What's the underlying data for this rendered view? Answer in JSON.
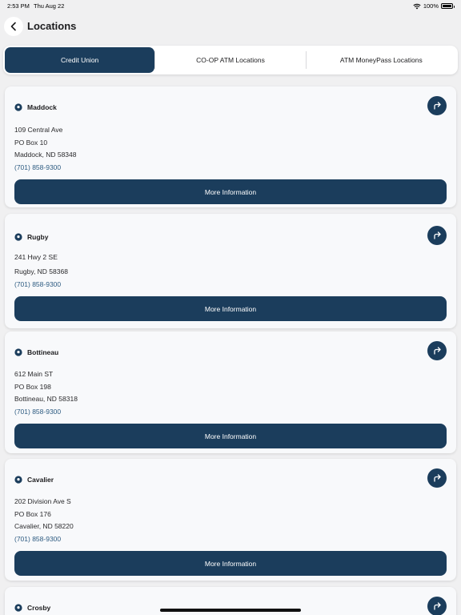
{
  "status": {
    "time": "2:53 PM",
    "date": "Thu Aug 22",
    "battery": "100%"
  },
  "nav": {
    "title": "Locations"
  },
  "tabs": [
    {
      "label": "Credit Union",
      "active": true
    },
    {
      "label": "CO-OP ATM Locations",
      "active": false
    },
    {
      "label": "ATM MoneyPass Locations",
      "active": false
    }
  ],
  "more_info_label": "More Information",
  "locations": [
    {
      "name": "Maddock",
      "lines": [
        "109 Central Ave",
        "PO Box 10",
        "Maddock, ND 58348"
      ],
      "phone": "(701) 858-9300"
    },
    {
      "name": "Rugby",
      "lines": [
        "241 Hwy 2 SE",
        "",
        "Rugby, ND 58368"
      ],
      "phone": "(701) 858-9300"
    },
    {
      "name": "Bottineau",
      "lines": [
        "612 Main ST",
        "PO Box 198",
        "Bottineau, ND 58318"
      ],
      "phone": "(701) 858-9300"
    },
    {
      "name": "Cavalier",
      "lines": [
        "202 Division Ave S",
        "PO Box 176",
        "Cavalier, ND 58220"
      ],
      "phone": "(701) 858-9300"
    },
    {
      "name": "Crosby",
      "lines": [],
      "phone": ""
    }
  ],
  "colors": {
    "primary": "#1b3d5c",
    "background": "#f0f0f1",
    "phone": "#2c5a80"
  }
}
